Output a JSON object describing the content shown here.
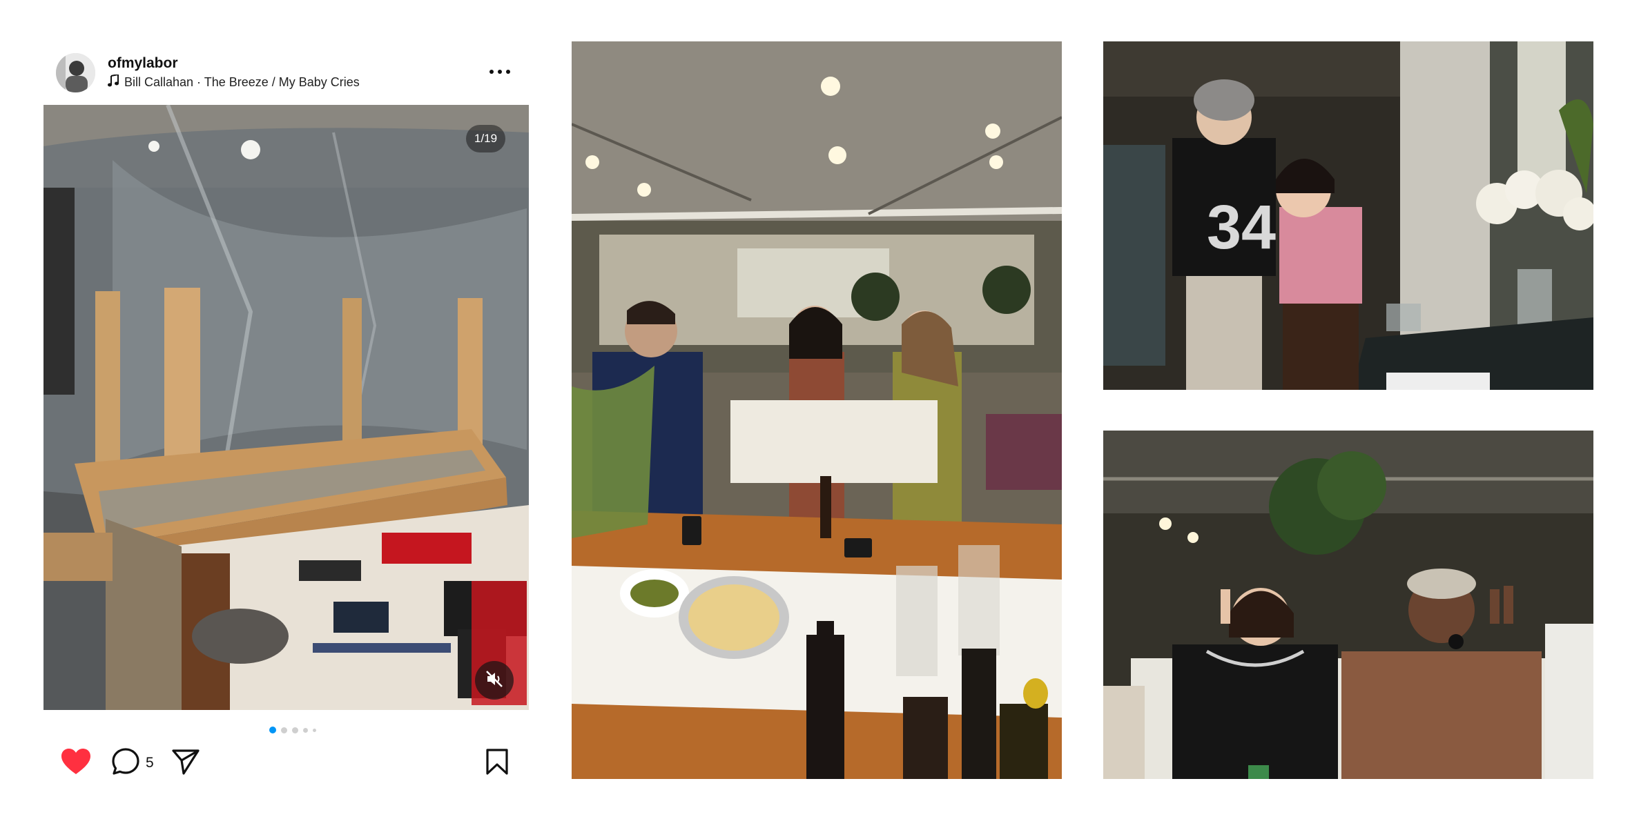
{
  "post": {
    "username": "ofmylabor",
    "music": {
      "icon": "music-note-icon",
      "text": "Bill Callahan · The Breeze / My Baby Cries"
    },
    "more_icon": "more-horizontal-icon",
    "media_counter": "1/19",
    "carousel": {
      "current": 1,
      "visible_dots": 5
    },
    "actions": {
      "like_icon": "heart-filled-icon",
      "liked": true,
      "like_color": "#ff3040",
      "comment_icon": "comment-icon",
      "comment_count": "5",
      "share_icon": "send-icon",
      "save_icon": "bookmark-icon"
    },
    "mute_icon": "muted-speaker-icon"
  },
  "colors": {
    "accent_dot": "#0095f6",
    "inactive_dot": "#cfcfcf"
  },
  "gallery": [
    {
      "name": "dinner-party-photo"
    },
    {
      "name": "two-women-photo"
    },
    {
      "name": "peace-sign-photo"
    }
  ]
}
